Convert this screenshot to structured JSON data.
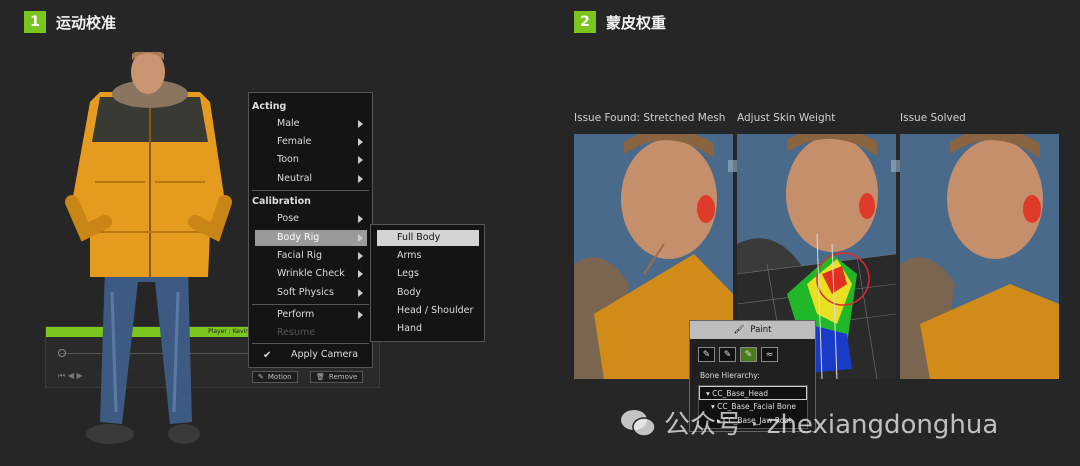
{
  "section1": {
    "num": "1",
    "title": "运动校准"
  },
  "section2": {
    "num": "2",
    "title": "蒙皮权重"
  },
  "timeline": {
    "bar_label": "Player : Kevin",
    "motion_button": "Motion",
    "remove_button": "Remove"
  },
  "menu": {
    "acting_header": "Acting",
    "acting_items": [
      "Male",
      "Female",
      "Toon",
      "Neutral"
    ],
    "calibration_header": "Calibration",
    "calibration_items": [
      "Pose",
      "Body Rig",
      "Facial Rig",
      "Wrinkle Check",
      "Soft Physics"
    ],
    "perform": "Perform",
    "resume": "Resume",
    "apply_camera": "Apply Camera"
  },
  "submenu": {
    "items": [
      "Full Body",
      "Arms",
      "Legs",
      "Body",
      "Head / Shoulder",
      "Hand"
    ]
  },
  "panels": {
    "labels": [
      "Issue Found: Stretched Mesh",
      "Adjust Skin Weight",
      "Issue Solved"
    ]
  },
  "paint": {
    "header": "Paint",
    "bone_label": "Bone Hierarchy:",
    "bones": [
      "CC_Base_Head",
      "CC_Base_Facial Bone",
      "CC_Base_Jaw Root"
    ]
  },
  "watermark": {
    "text": "公众号 · zhexiangdonghua"
  },
  "colors": {
    "accent": "#7cc51f",
    "menu_bg": "#141414",
    "bg": "#262626"
  }
}
